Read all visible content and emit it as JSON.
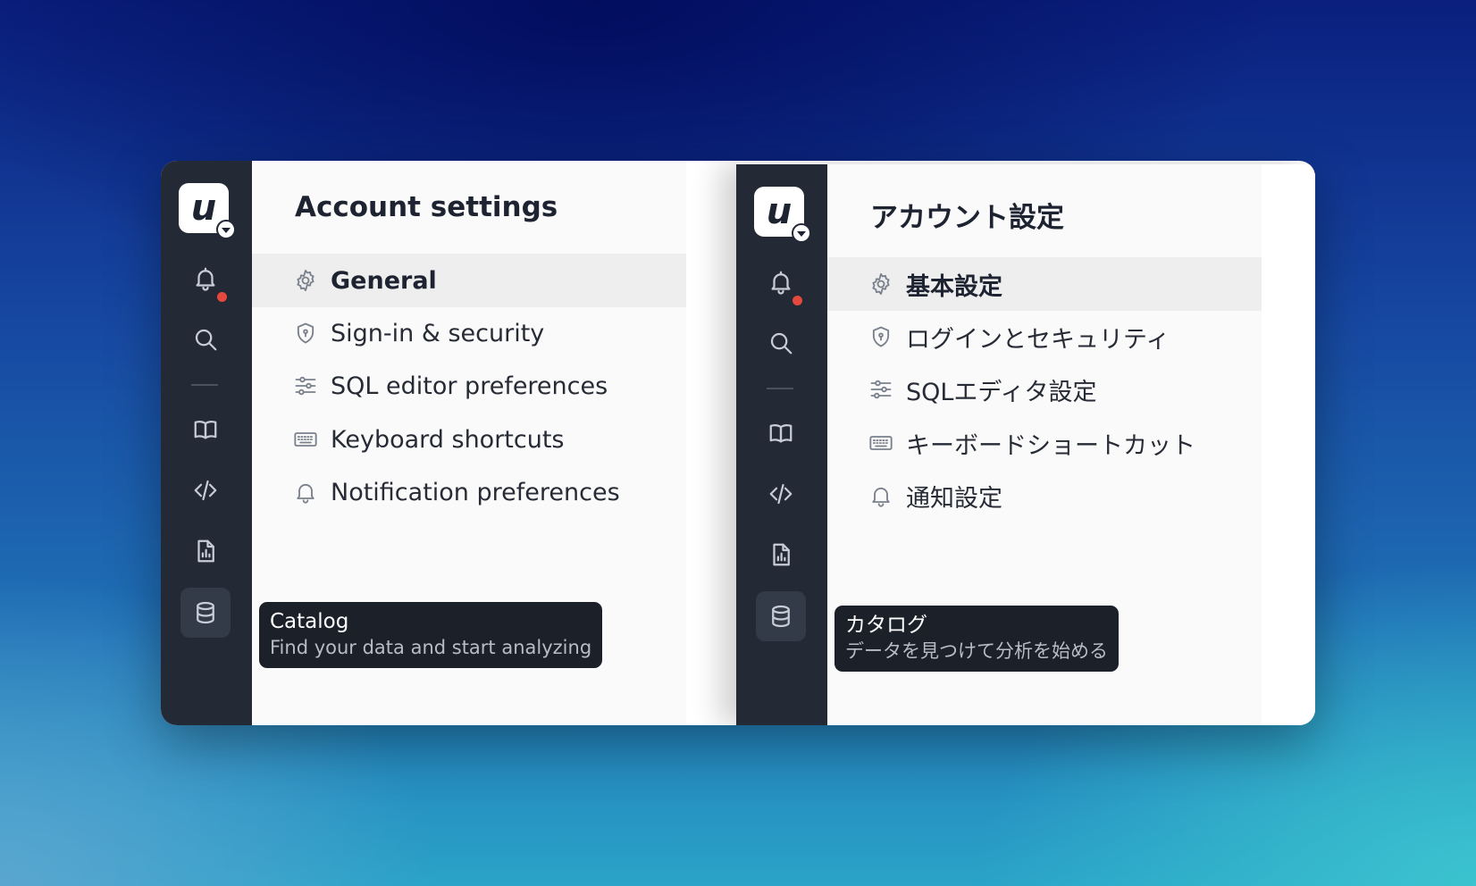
{
  "panels": [
    {
      "title": "Account settings",
      "menu": [
        {
          "label": "General",
          "icon": "gear-icon",
          "active": true
        },
        {
          "label": "Sign-in & security",
          "icon": "shield-icon",
          "active": false
        },
        {
          "label": "SQL editor preferences",
          "icon": "sliders-icon",
          "active": false
        },
        {
          "label": "Keyboard shortcuts",
          "icon": "keyboard-icon",
          "active": false
        },
        {
          "label": "Notification preferences",
          "icon": "bell-icon",
          "active": false
        }
      ],
      "tooltip": {
        "title": "Catalog",
        "description": "Find your data and start analyzing"
      }
    },
    {
      "title": "アカウント設定",
      "menu": [
        {
          "label": "基本設定",
          "icon": "gear-icon",
          "active": true
        },
        {
          "label": "ログインとセキュリティ",
          "icon": "shield-icon",
          "active": false
        },
        {
          "label": "SQLエディタ設定",
          "icon": "sliders-icon",
          "active": false
        },
        {
          "label": "キーボードショートカット",
          "icon": "keyboard-icon",
          "active": false
        },
        {
          "label": "通知設定",
          "icon": "bell-icon",
          "active": false
        }
      ],
      "tooltip": {
        "title": "カタログ",
        "description": "データを見つけて分析を始める"
      }
    }
  ],
  "rail": {
    "logo_glyph": "u",
    "items": [
      "notifications-icon",
      "search-icon",
      "book-icon",
      "code-icon",
      "report-icon",
      "database-icon"
    ],
    "active_item": "database-icon",
    "notification_badge_color": "#e5493d"
  },
  "colors": {
    "rail_bg": "#232a36",
    "content_bg": "#fafafa",
    "active_row_bg": "#eeeeef",
    "tooltip_bg": "#1c2029"
  }
}
